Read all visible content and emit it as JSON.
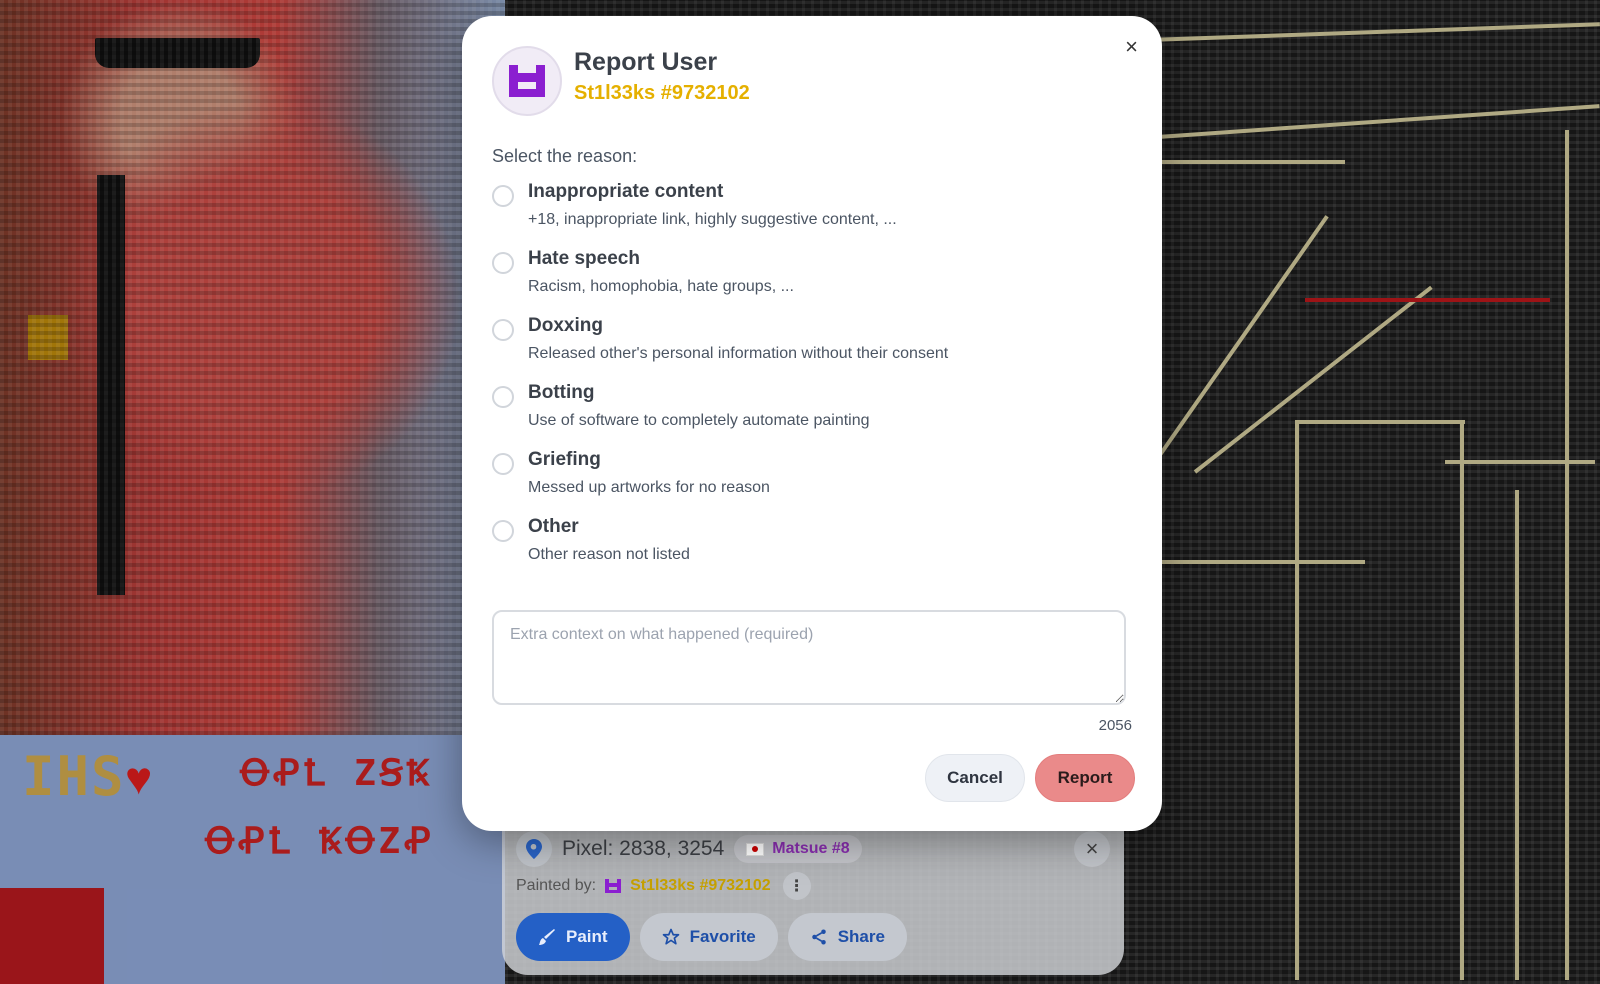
{
  "dialog": {
    "title": "Report User",
    "subtitle": "St1l33ks #9732102",
    "reason_prompt": "Select the reason:",
    "reasons": [
      {
        "title": "Inappropriate content",
        "description": "+18, inappropriate link, highly suggestive content, ..."
      },
      {
        "title": "Hate speech",
        "description": "Racism, homophobia, hate groups, ..."
      },
      {
        "title": "Doxxing",
        "description": "Released other's personal information without their consent"
      },
      {
        "title": "Botting",
        "description": "Use of software to completely automate painting"
      },
      {
        "title": "Griefing",
        "description": "Messed up artworks for no reason"
      },
      {
        "title": "Other",
        "description": "Other reason not listed"
      }
    ],
    "context": {
      "placeholder": "Extra context on what happened (required)",
      "value": ""
    },
    "char_counter": "2056",
    "cancel_label": "Cancel",
    "report_label": "Report",
    "close_icon": "×"
  },
  "pixel_panel": {
    "title": "Pixel: 2838, 3254",
    "location": "Matsue #8",
    "painted_by_label": "Painted by:",
    "painted_by_user": "St1l33ks #9732102",
    "more_icon": "⋮",
    "close_icon": "×",
    "actions": {
      "paint": "Paint",
      "favorite": "Favorite",
      "share": "Share"
    }
  },
  "canvas": {
    "left_text": "IHS",
    "glyphs_top": "ꝊꝒꝈ ZꞨꝄ",
    "glyphs_bottom": "ꝊꝒꝈ ꝄꝊZꝒ"
  },
  "colors": {
    "accent_gold": "#e5b000",
    "avatar_purple": "#8b1fd0",
    "report_red": "#ea8a8a",
    "paint_blue": "#2460c6"
  }
}
